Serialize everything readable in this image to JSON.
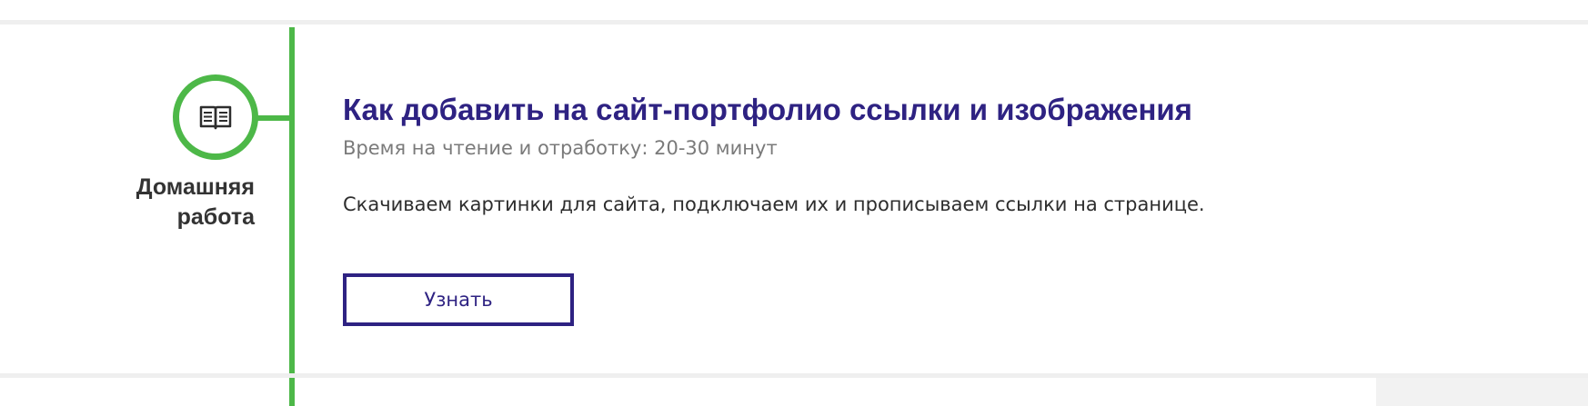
{
  "lesson": {
    "type_label": "Домашняя работа",
    "type_icon": "open-book-icon",
    "title": "Как добавить на сайт-портфолио ссылки и изображения",
    "reading_time": "Время на чтение и отработку: 20-30 минут",
    "description": "Скачиваем картинки для сайта, подключаем их и прописываем ссылки на странице.",
    "button_label": "Узнать"
  },
  "colors": {
    "accent_green": "#4db848",
    "title_purple": "#2e2282",
    "muted_text": "#7a7a7a",
    "body_text": "#2d2d2d",
    "divider": "#efefef"
  }
}
